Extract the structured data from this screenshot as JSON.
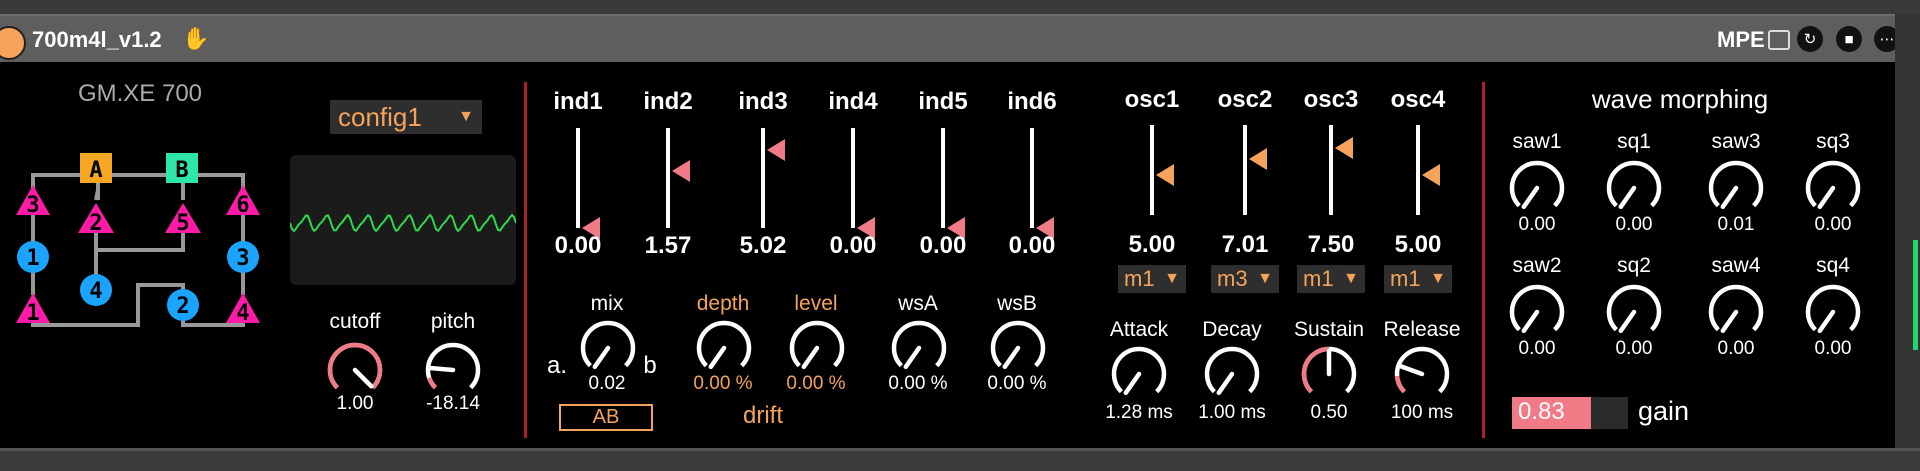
{
  "window": {
    "title": "700m4l_v1.2",
    "mpe_label": "MPE",
    "icons": [
      "hand-icon",
      "clipboard-icon",
      "refresh-icon",
      "save-icon",
      "more-icon"
    ]
  },
  "colors": {
    "accent_orange": "#f5a35a",
    "divider_red": "#b0202a",
    "knob_pink": "#f07a86",
    "wave_green": "#2fd84c",
    "op_pink": "#ff1aa8",
    "op_blue": "#1aa3ff",
    "carrier_orange": "#f5a623",
    "carrier_green": "#2ee6a8"
  },
  "algo": {
    "device_name": "GM.XE 700",
    "ops": [
      "A",
      "B",
      "1",
      "2",
      "3",
      "4",
      "5",
      "6"
    ]
  },
  "config": {
    "selected": "config1"
  },
  "filter": {
    "cutoff_label": "cutoff",
    "cutoff_value": "1.00",
    "pitch_label": "pitch",
    "pitch_value": "-18.14"
  },
  "index": [
    {
      "label": "ind1",
      "value": "0.00",
      "level": 0.0
    },
    {
      "label": "ind2",
      "value": "1.57",
      "level": 0.57
    },
    {
      "label": "ind3",
      "value": "5.02",
      "level": 0.78
    },
    {
      "label": "ind4",
      "value": "0.00",
      "level": 0.0
    },
    {
      "label": "ind5",
      "value": "0.00",
      "level": 0.0
    },
    {
      "label": "ind6",
      "value": "0.00",
      "level": 0.0
    }
  ],
  "mix": {
    "label": "mix",
    "value": "0.02",
    "a_label": "a.",
    "b_label": "b",
    "ab_button": "AB"
  },
  "drift": {
    "label": "drift",
    "depth_label": "depth",
    "depth_value": "0.00 %",
    "level_label": "level",
    "level_value": "0.00 %"
  },
  "ws": {
    "a_label": "wsA",
    "a_value": "0.00 %",
    "b_label": "wsB",
    "b_value": "0.00 %"
  },
  "osc": [
    {
      "label": "osc1",
      "value": "5.00",
      "mode": "m1",
      "level": 0.45
    },
    {
      "label": "osc2",
      "value": "7.01",
      "mode": "m3",
      "level": 0.62
    },
    {
      "label": "osc3",
      "value": "7.50",
      "mode": "m1",
      "level": 0.75
    },
    {
      "label": "osc4",
      "value": "5.00",
      "mode": "m1",
      "level": 0.45
    }
  ],
  "env": [
    {
      "label": "Attack",
      "value": "1.28 ms"
    },
    {
      "label": "Decay",
      "value": "1.00 ms"
    },
    {
      "label": "Sustain",
      "value": "0.50"
    },
    {
      "label": "Release",
      "value": "100 ms"
    }
  ],
  "morph": {
    "title": "wave morphing",
    "knobs": [
      {
        "label": "saw1",
        "value": "0.00"
      },
      {
        "label": "sq1",
        "value": "0.00"
      },
      {
        "label": "saw3",
        "value": "0.01"
      },
      {
        "label": "sq3",
        "value": "0.00"
      },
      {
        "label": "saw2",
        "value": "0.00"
      },
      {
        "label": "sq2",
        "value": "0.00"
      },
      {
        "label": "saw4",
        "value": "0.00"
      },
      {
        "label": "sq4",
        "value": "0.00"
      }
    ]
  },
  "gain": {
    "label": "gain",
    "value": "0.83",
    "level": 0.83
  }
}
